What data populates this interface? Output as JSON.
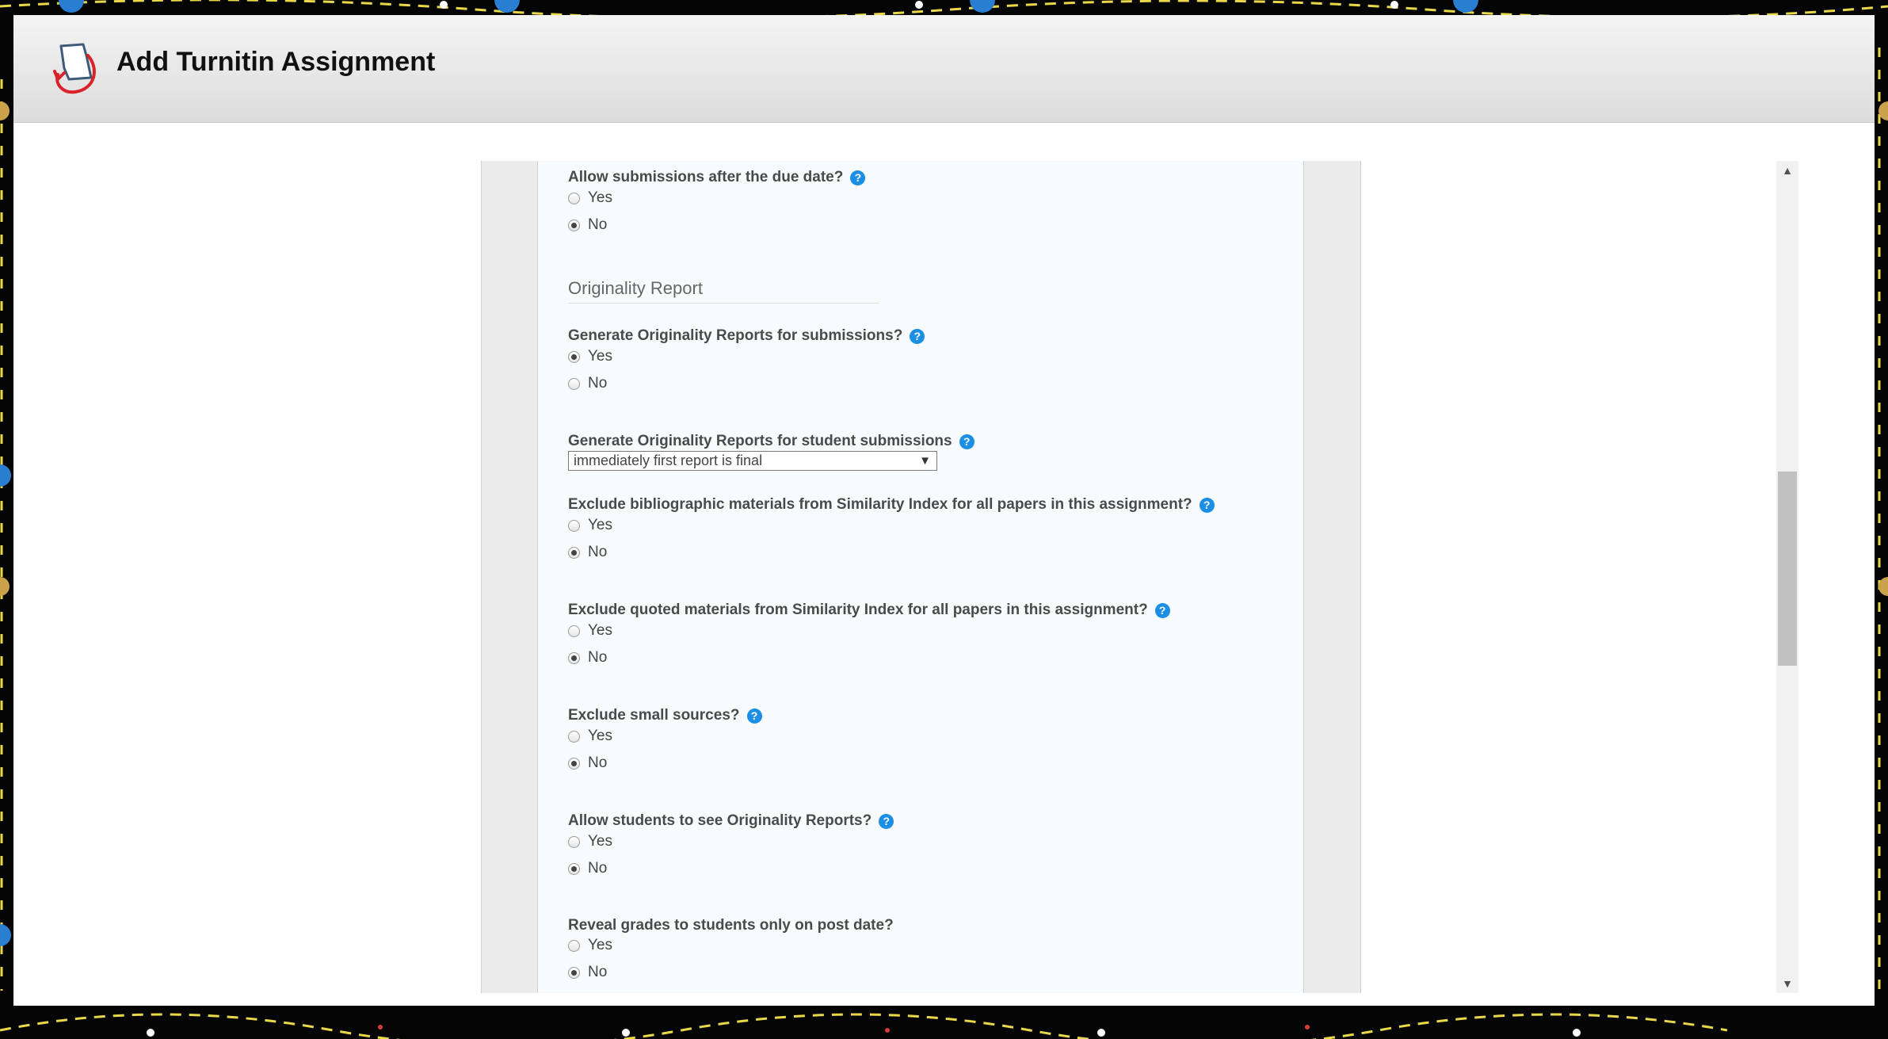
{
  "window": {
    "title": "Add Turnitin Assignment",
    "logo_icon": "turnitin-logo-icon"
  },
  "form": {
    "q_late": {
      "label": "Allow submissions after the due date?",
      "options": [
        "Yes",
        "No"
      ],
      "selected": "No"
    },
    "section_originality": "Originality Report",
    "q_generate": {
      "label": "Generate Originality Reports for submissions?",
      "options": [
        "Yes",
        "No"
      ],
      "selected": "Yes"
    },
    "q_generate_student": {
      "label": "Generate Originality Reports for student submissions",
      "value": "immediately first report is final",
      "arrow": "▼"
    },
    "q_biblio": {
      "label": "Exclude bibliographic materials from Similarity Index for all papers in this assignment?",
      "options": [
        "Yes",
        "No"
      ],
      "selected": "No"
    },
    "q_quoted": {
      "label": "Exclude quoted materials from Similarity Index for all papers in this assignment?",
      "options": [
        "Yes",
        "No"
      ],
      "selected": "No"
    },
    "q_small": {
      "label": "Exclude small sources?",
      "options": [
        "Yes",
        "No"
      ],
      "selected": "No"
    },
    "q_students_see": {
      "label": "Allow students to see Originality Reports?",
      "options": [
        "Yes",
        "No"
      ],
      "selected": "No"
    },
    "q_reveal": {
      "label": "Reveal grades to students only on post date?",
      "options": [
        "Yes",
        "No"
      ],
      "selected": "No"
    },
    "help_glyph": "?"
  },
  "scrollbar": {
    "up": "▲",
    "down": "▼",
    "position": 0.35
  },
  "colors": {
    "help_icon": "#1b8fe6",
    "panel_background": "#f7fbfe",
    "header_gradient_top": "#f4f4f4",
    "header_gradient_bottom": "#dcdcdc"
  }
}
